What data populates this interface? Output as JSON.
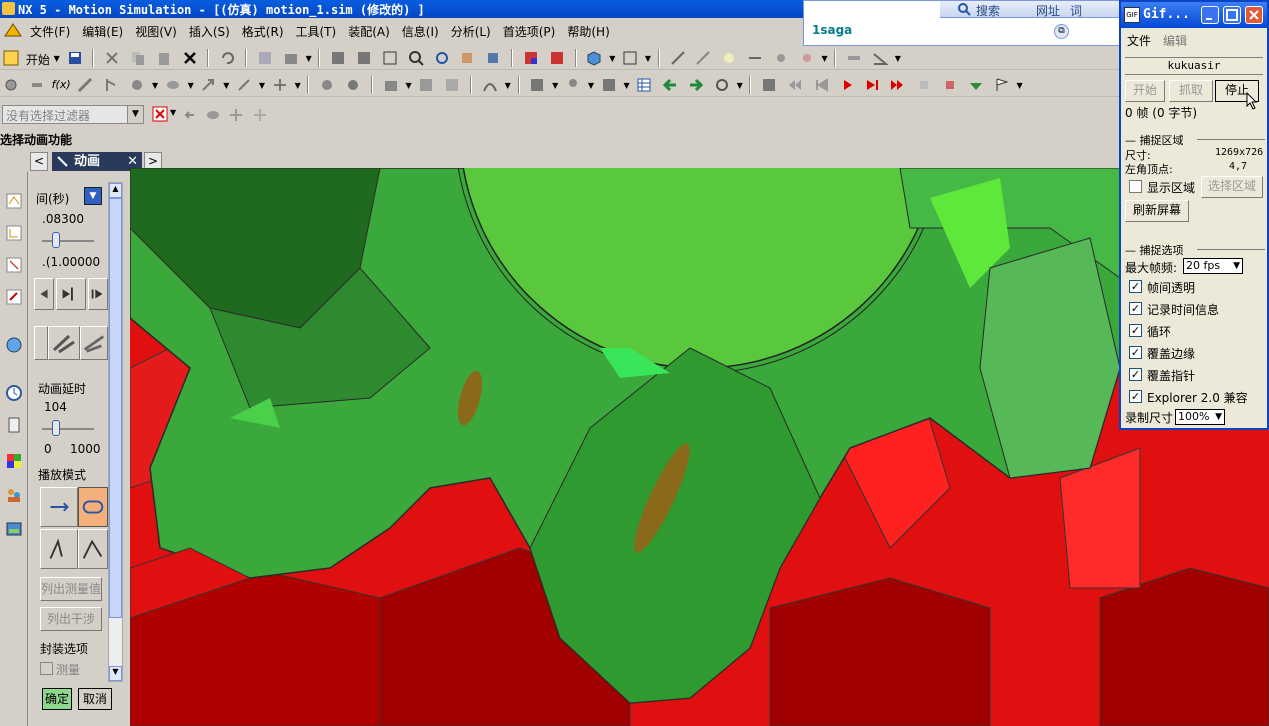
{
  "window": {
    "title": "NX 5 - Motion Simulation - [(仿真) motion_1.sim  (修改的) ]"
  },
  "menubar": {
    "items": [
      "文件(F)",
      "编辑(E)",
      "视图(V)",
      "插入(S)",
      "格式(R)",
      "工具(T)",
      "装配(A)",
      "信息(I)",
      "分析(L)",
      "首选项(P)",
      "帮助(H)"
    ]
  },
  "toolbar": {
    "start_label": "开始",
    "fx_label": "f(x)"
  },
  "filter": {
    "placeholder": "没有选择过滤器"
  },
  "status": {
    "prompt": "选择动画功能"
  },
  "animation_tab": {
    "label": "动画"
  },
  "animation_panel": {
    "time_label": "间(秒)",
    "time_value": ".08300",
    "time_value_2": ".(1.00000",
    "delay_label": "动画延时",
    "delay_value": "104",
    "delay_min": "0",
    "delay_max": "1000",
    "playback_mode_label": "播放模式",
    "list_measures_button": "列出测量值",
    "list_interference_button": "列出干涉",
    "packaging_options_label": "封装选项",
    "measure_checkbox_label": "测量",
    "ok_button": "确定",
    "cancel_button": "取消"
  },
  "ie_bar": {
    "search_label": "搜索",
    "address_label": "网址",
    "words_label": "词",
    "text": "1saga"
  },
  "gif_window": {
    "title": "Gif...",
    "menu": [
      "文件",
      "编辑"
    ],
    "name": "kukuasir",
    "start_button": "开始",
    "capture_button": "抓取",
    "stop_button": "停止",
    "frames_text": "0 帧 (0 字节)",
    "capture_area_label": "捕捉区域",
    "size_label": "尺寸:",
    "size_value": "1269x726",
    "corner_label": "左角顶点:",
    "corner_value": "4,7",
    "show_area_label": "显示区域",
    "select_area_button": "选择区域",
    "refresh_button": "刷新屏幕",
    "capture_options_label": "捕捉选项",
    "max_fps_label": "最大帧频:",
    "max_fps_value": "20 fps",
    "options": [
      {
        "label": "帧间透明",
        "checked": true
      },
      {
        "label": "记录时间信息",
        "checked": true
      },
      {
        "label": "循环",
        "checked": true
      },
      {
        "label": "覆盖边缘",
        "checked": true
      },
      {
        "label": "覆盖指针",
        "checked": true
      },
      {
        "label": "Explorer 2.0 兼容",
        "checked": true
      }
    ],
    "record_size_label": "录制尺寸",
    "record_size_value": "100%"
  },
  "colors": {
    "gear_green": "#3aa83a",
    "rack_red": "#cc0000",
    "titlebar_blue": "#0a5de0"
  }
}
